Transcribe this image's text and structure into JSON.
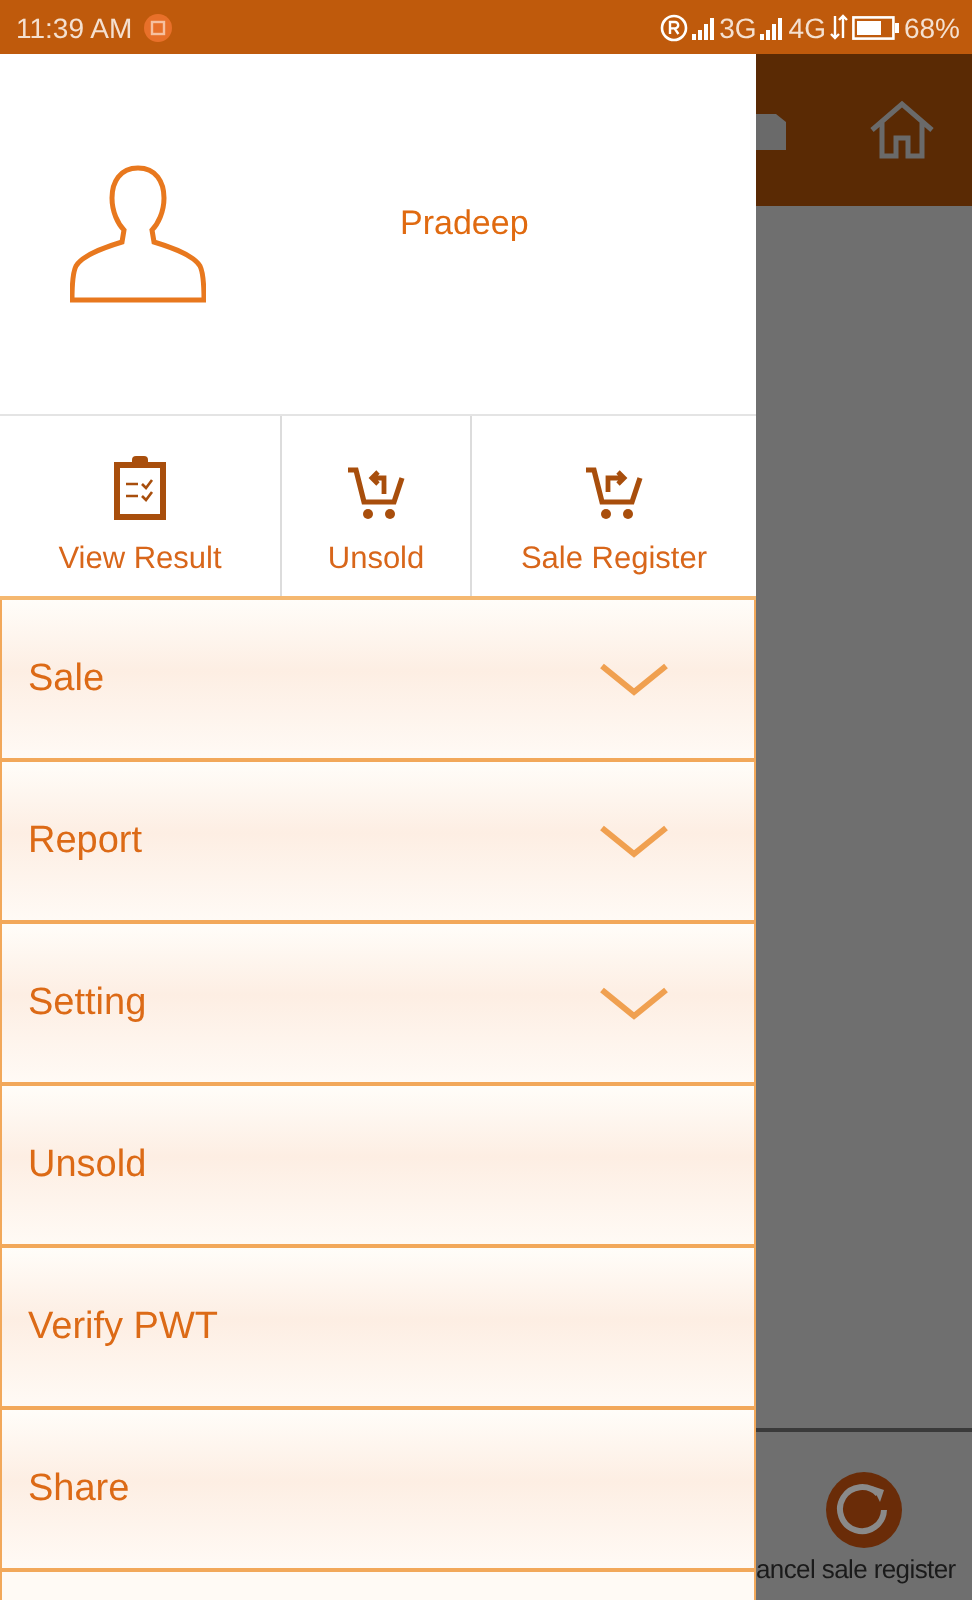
{
  "status_bar": {
    "time": "11:39 AM",
    "network_1": "3G",
    "network_2": "4G",
    "battery": "68%"
  },
  "drawer": {
    "user_name": "Pradeep",
    "quick_actions": [
      {
        "label": "View Result",
        "kind": "clipboard"
      },
      {
        "label": "Unsold",
        "kind": "cart-return"
      },
      {
        "label": "Sale Register",
        "kind": "cart-forward"
      }
    ],
    "menu": [
      {
        "label": "Sale",
        "kind": "group"
      },
      {
        "label": "Report",
        "kind": "group"
      },
      {
        "label": "Setting",
        "kind": "group"
      },
      {
        "label": "Unsold",
        "kind": "link"
      },
      {
        "label": "Verify PWT",
        "kind": "link"
      },
      {
        "label": "Share",
        "kind": "link"
      }
    ]
  },
  "background": {
    "bottom_action": "ancel sale register"
  }
}
